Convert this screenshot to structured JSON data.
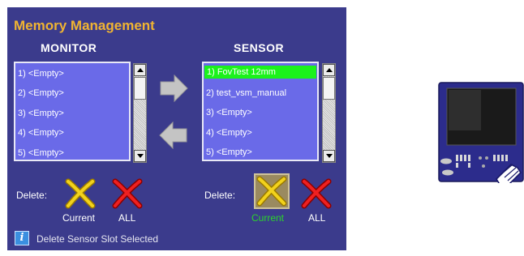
{
  "title": "Memory Management",
  "monitor": {
    "heading": "MONITOR",
    "items": [
      "1) <Empty>",
      "2) <Empty>",
      "3) <Empty>",
      "4) <Empty>",
      "5) <Empty>"
    ],
    "delete_label": "Delete:",
    "current_label": "Current",
    "all_label": "ALL"
  },
  "sensor": {
    "heading": "SENSOR",
    "items": [
      "1) FovTest 12mm",
      "2) test_vsm_manual",
      "3) <Empty>",
      "4) <Empty>",
      "5) <Empty>"
    ],
    "selected_index": 0,
    "delete_label": "Delete:",
    "current_label": "Current",
    "all_label": "ALL"
  },
  "status": {
    "text": "Delete Sensor Slot Selected"
  },
  "icons": {
    "copy_right": "arrow-right-icon",
    "copy_left": "arrow-left-icon",
    "delete_current": "yellow-x-icon",
    "delete_all": "red-x-icon",
    "info": "info-icon",
    "device": "handheld-device-icon"
  },
  "colors": {
    "panel": "#3b3b8c",
    "title": "#f0b432",
    "list_bg": "#6a6ae8",
    "selected": "#1bf21b",
    "current_active": "#2bd42b"
  }
}
